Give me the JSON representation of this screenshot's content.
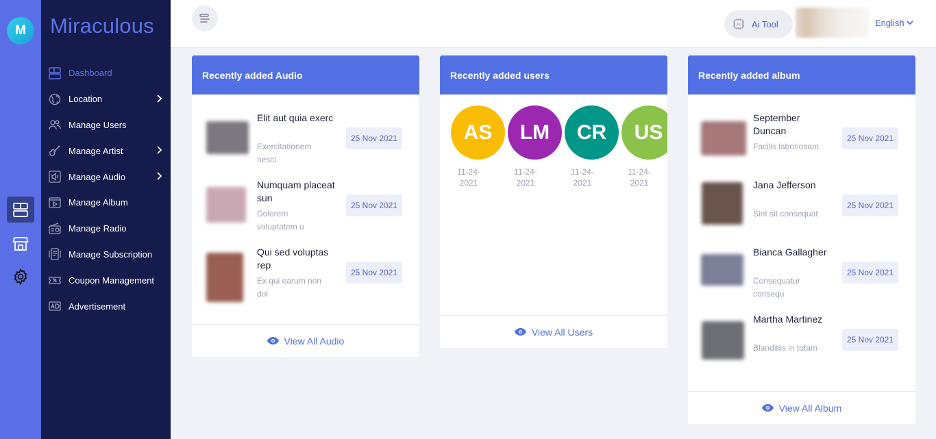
{
  "app": {
    "logo_letter": "M",
    "brand": "Miraculous"
  },
  "rail": {
    "items": [
      "dashboard-icon",
      "store-icon",
      "gear-icon"
    ]
  },
  "sidebar": {
    "items": [
      {
        "label": "Dashboard",
        "icon": "dashboard-icon",
        "active": true,
        "has_submenu": false
      },
      {
        "label": "Location",
        "icon": "globe-icon",
        "has_submenu": true
      },
      {
        "label": "Manage Users",
        "icon": "users-icon",
        "has_submenu": false
      },
      {
        "label": "Manage Artist",
        "icon": "guitar-icon",
        "has_submenu": true
      },
      {
        "label": "Manage Audio",
        "icon": "speaker-icon",
        "has_submenu": true
      },
      {
        "label": "Manage Album",
        "icon": "play-icon",
        "has_submenu": false
      },
      {
        "label": "Manage Radio",
        "icon": "radio-icon",
        "has_submenu": false
      },
      {
        "label": "Manage Subscription",
        "icon": "subscription-icon",
        "has_submenu": false
      },
      {
        "label": "Coupon Management",
        "icon": "coupon-icon",
        "has_submenu": false
      },
      {
        "label": "Advertisement",
        "icon": "advertisement-icon",
        "has_submenu": false
      }
    ]
  },
  "header": {
    "ai_tool_label": "Ai Tool",
    "ai_tool_icon_text": "AI",
    "language": "English"
  },
  "audio_card": {
    "title": "Recently added Audio",
    "footer": "View All Audio",
    "items": [
      {
        "title": "Elit aut quia exerc",
        "subtitle": "Exercitationem nesci",
        "date": "25 Nov 2021",
        "thumb_color": "#7d7780"
      },
      {
        "title": "Numquam placeat sun",
        "subtitle": "Dolorem voluptatem u",
        "date": "25 Nov 2021",
        "thumb_color": "#c9a8b4"
      },
      {
        "title": "Qui sed voluptas rep",
        "subtitle": "Ex qui earum non dol",
        "date": "25 Nov 2021",
        "thumb_color": "#9a5e52"
      }
    ]
  },
  "users_card": {
    "title": "Recently added users",
    "footer": "View All Users",
    "items": [
      {
        "initials": "AS",
        "date": "11-24-2021",
        "color": "#fbbc05"
      },
      {
        "initials": "LM",
        "date": "11-24-2021",
        "color": "#9c27b0"
      },
      {
        "initials": "CR",
        "date": "11-24-2021",
        "color": "#009688"
      },
      {
        "initials": "US",
        "date": "11-24-2021",
        "color": "#8bc34a"
      }
    ]
  },
  "album_card": {
    "title": "Recently added album",
    "footer": "View All Album",
    "items": [
      {
        "title": "September Duncan",
        "subtitle": "Facilis laboriosam",
        "date": "25 Nov 2021",
        "thumb_color": "#a5787a"
      },
      {
        "title": "Jana Jefferson",
        "subtitle": "Sint sit consequat",
        "date": "25 Nov 2021",
        "thumb_color": "#6a554e"
      },
      {
        "title": "Bianca Gallagher",
        "subtitle": "Consequatur consequ",
        "date": "25 Nov 2021",
        "thumb_color": "#7b7f98"
      },
      {
        "title": "Martha Martinez",
        "subtitle": "Blanditiis in totam",
        "date": "25 Nov 2021",
        "thumb_color": "#6d6f75"
      }
    ]
  },
  "colors": {
    "accent": "#5270e3",
    "sidebar_bg": "#151b4a",
    "rail_bg": "#5a6ee6"
  }
}
